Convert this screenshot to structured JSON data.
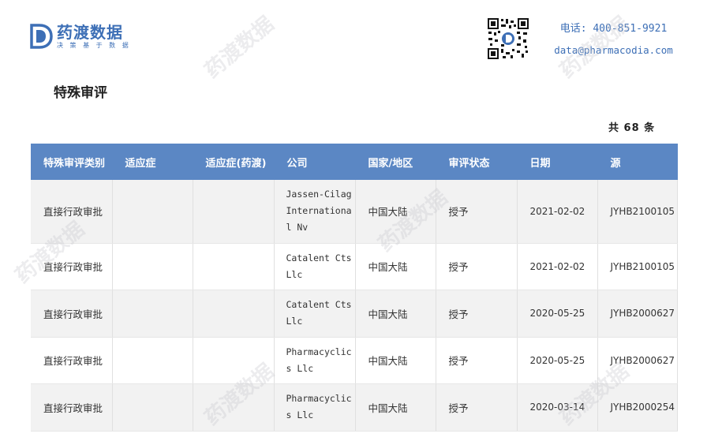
{
  "brand": {
    "name": "药渡数据",
    "slogan": "决 策 基 于 数 据",
    "primary_color": "#3d6fb6"
  },
  "contact": {
    "phone": "电话: 400-851-9921",
    "email": "data@pharmacodia.com"
  },
  "page": {
    "title": "特殊审评",
    "total": "共 68 条"
  },
  "table": {
    "header_color": "#5b87c4",
    "columns": [
      "特殊审评类别",
      "适应症",
      "适应症(药渡)",
      "公司",
      "国家/地区",
      "审评状态",
      "日期",
      "源"
    ],
    "rows": [
      [
        "直接行政审批",
        "",
        "",
        "Jassen-Cilag International Nv",
        "中国大陆",
        "授予",
        "2021-02-02",
        "JYHB2100105"
      ],
      [
        "直接行政审批",
        "",
        "",
        "Catalent Cts Llc",
        "中国大陆",
        "授予",
        "2021-02-02",
        "JYHB2100105"
      ],
      [
        "直接行政审批",
        "",
        "",
        "Catalent Cts Llc",
        "中国大陆",
        "授予",
        "2020-05-25",
        "JYHB2000627"
      ],
      [
        "直接行政审批",
        "",
        "",
        "Pharmacyclics Llc",
        "中国大陆",
        "授予",
        "2020-05-25",
        "JYHB2000627"
      ],
      [
        "直接行政审批",
        "",
        "",
        "Pharmacyclics Llc",
        "中国大陆",
        "授予",
        "2020-03-14",
        "JYHB2000254"
      ]
    ]
  }
}
